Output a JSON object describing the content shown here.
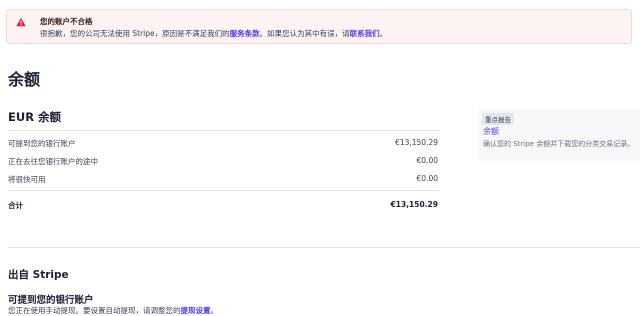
{
  "alert": {
    "title": "您的账户不合格",
    "body_prefix": "很抱歉，您的公司无法使用 Stripe，原因是不满足我们的",
    "terms_link": "服务条款",
    "body_middle": "。如果您认为其中有误，请",
    "contact_link": "联系我们",
    "body_suffix": "。",
    "icon": "warning-icon",
    "accent": "#df1b41"
  },
  "page": {
    "title": "余额"
  },
  "balance": {
    "section_title": "EUR 余额",
    "rows": [
      {
        "label": "可提到您的银行账户",
        "amount": "€13,150.29"
      },
      {
        "label": "正在去往您银行账户的途中",
        "amount": "€0.00"
      },
      {
        "label": "将很快可用",
        "amount": "€0.00"
      }
    ],
    "total": {
      "label": "合计",
      "amount": "€13,150.29"
    }
  },
  "report": {
    "tag": "重点报告",
    "link": "余额",
    "description": "确认您的 Stripe 余额并下载您的分类交易记录。"
  },
  "payouts": {
    "title": "出自 Stripe",
    "subtitle": "可提到您的银行账户",
    "note_prefix": "您正在使用手动提现。要设置自动提现，请调整您的",
    "note_link": "提现设置",
    "note_suffix": "。"
  },
  "colors": {
    "link": "#533afd",
    "text": "#1a1f36",
    "muted": "#697386"
  }
}
